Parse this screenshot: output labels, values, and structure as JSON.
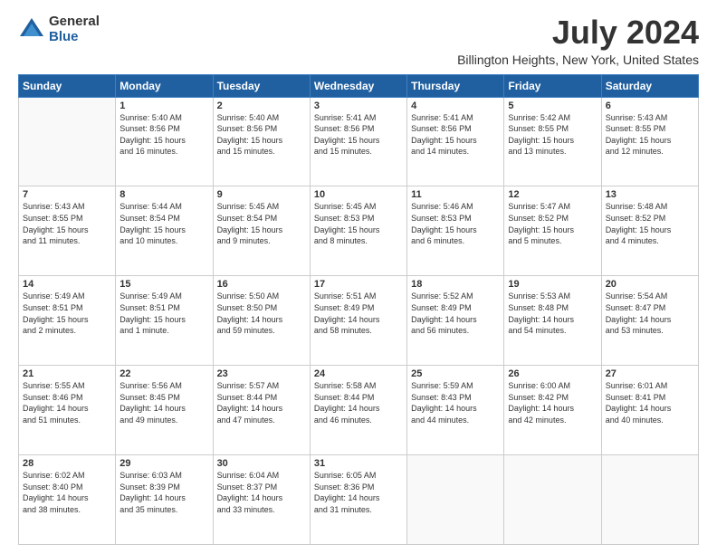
{
  "logo": {
    "general": "General",
    "blue": "Blue"
  },
  "title": "July 2024",
  "subtitle": "Billington Heights, New York, United States",
  "headers": [
    "Sunday",
    "Monday",
    "Tuesday",
    "Wednesday",
    "Thursday",
    "Friday",
    "Saturday"
  ],
  "weeks": [
    [
      {
        "day": "",
        "info": ""
      },
      {
        "day": "1",
        "info": "Sunrise: 5:40 AM\nSunset: 8:56 PM\nDaylight: 15 hours\nand 16 minutes."
      },
      {
        "day": "2",
        "info": "Sunrise: 5:40 AM\nSunset: 8:56 PM\nDaylight: 15 hours\nand 15 minutes."
      },
      {
        "day": "3",
        "info": "Sunrise: 5:41 AM\nSunset: 8:56 PM\nDaylight: 15 hours\nand 15 minutes."
      },
      {
        "day": "4",
        "info": "Sunrise: 5:41 AM\nSunset: 8:56 PM\nDaylight: 15 hours\nand 14 minutes."
      },
      {
        "day": "5",
        "info": "Sunrise: 5:42 AM\nSunset: 8:55 PM\nDaylight: 15 hours\nand 13 minutes."
      },
      {
        "day": "6",
        "info": "Sunrise: 5:43 AM\nSunset: 8:55 PM\nDaylight: 15 hours\nand 12 minutes."
      }
    ],
    [
      {
        "day": "7",
        "info": "Sunrise: 5:43 AM\nSunset: 8:55 PM\nDaylight: 15 hours\nand 11 minutes."
      },
      {
        "day": "8",
        "info": "Sunrise: 5:44 AM\nSunset: 8:54 PM\nDaylight: 15 hours\nand 10 minutes."
      },
      {
        "day": "9",
        "info": "Sunrise: 5:45 AM\nSunset: 8:54 PM\nDaylight: 15 hours\nand 9 minutes."
      },
      {
        "day": "10",
        "info": "Sunrise: 5:45 AM\nSunset: 8:53 PM\nDaylight: 15 hours\nand 8 minutes."
      },
      {
        "day": "11",
        "info": "Sunrise: 5:46 AM\nSunset: 8:53 PM\nDaylight: 15 hours\nand 6 minutes."
      },
      {
        "day": "12",
        "info": "Sunrise: 5:47 AM\nSunset: 8:52 PM\nDaylight: 15 hours\nand 5 minutes."
      },
      {
        "day": "13",
        "info": "Sunrise: 5:48 AM\nSunset: 8:52 PM\nDaylight: 15 hours\nand 4 minutes."
      }
    ],
    [
      {
        "day": "14",
        "info": "Sunrise: 5:49 AM\nSunset: 8:51 PM\nDaylight: 15 hours\nand 2 minutes."
      },
      {
        "day": "15",
        "info": "Sunrise: 5:49 AM\nSunset: 8:51 PM\nDaylight: 15 hours\nand 1 minute."
      },
      {
        "day": "16",
        "info": "Sunrise: 5:50 AM\nSunset: 8:50 PM\nDaylight: 14 hours\nand 59 minutes."
      },
      {
        "day": "17",
        "info": "Sunrise: 5:51 AM\nSunset: 8:49 PM\nDaylight: 14 hours\nand 58 minutes."
      },
      {
        "day": "18",
        "info": "Sunrise: 5:52 AM\nSunset: 8:49 PM\nDaylight: 14 hours\nand 56 minutes."
      },
      {
        "day": "19",
        "info": "Sunrise: 5:53 AM\nSunset: 8:48 PM\nDaylight: 14 hours\nand 54 minutes."
      },
      {
        "day": "20",
        "info": "Sunrise: 5:54 AM\nSunset: 8:47 PM\nDaylight: 14 hours\nand 53 minutes."
      }
    ],
    [
      {
        "day": "21",
        "info": "Sunrise: 5:55 AM\nSunset: 8:46 PM\nDaylight: 14 hours\nand 51 minutes."
      },
      {
        "day": "22",
        "info": "Sunrise: 5:56 AM\nSunset: 8:45 PM\nDaylight: 14 hours\nand 49 minutes."
      },
      {
        "day": "23",
        "info": "Sunrise: 5:57 AM\nSunset: 8:44 PM\nDaylight: 14 hours\nand 47 minutes."
      },
      {
        "day": "24",
        "info": "Sunrise: 5:58 AM\nSunset: 8:44 PM\nDaylight: 14 hours\nand 46 minutes."
      },
      {
        "day": "25",
        "info": "Sunrise: 5:59 AM\nSunset: 8:43 PM\nDaylight: 14 hours\nand 44 minutes."
      },
      {
        "day": "26",
        "info": "Sunrise: 6:00 AM\nSunset: 8:42 PM\nDaylight: 14 hours\nand 42 minutes."
      },
      {
        "day": "27",
        "info": "Sunrise: 6:01 AM\nSunset: 8:41 PM\nDaylight: 14 hours\nand 40 minutes."
      }
    ],
    [
      {
        "day": "28",
        "info": "Sunrise: 6:02 AM\nSunset: 8:40 PM\nDaylight: 14 hours\nand 38 minutes."
      },
      {
        "day": "29",
        "info": "Sunrise: 6:03 AM\nSunset: 8:39 PM\nDaylight: 14 hours\nand 35 minutes."
      },
      {
        "day": "30",
        "info": "Sunrise: 6:04 AM\nSunset: 8:37 PM\nDaylight: 14 hours\nand 33 minutes."
      },
      {
        "day": "31",
        "info": "Sunrise: 6:05 AM\nSunset: 8:36 PM\nDaylight: 14 hours\nand 31 minutes."
      },
      {
        "day": "",
        "info": ""
      },
      {
        "day": "",
        "info": ""
      },
      {
        "day": "",
        "info": ""
      }
    ]
  ]
}
